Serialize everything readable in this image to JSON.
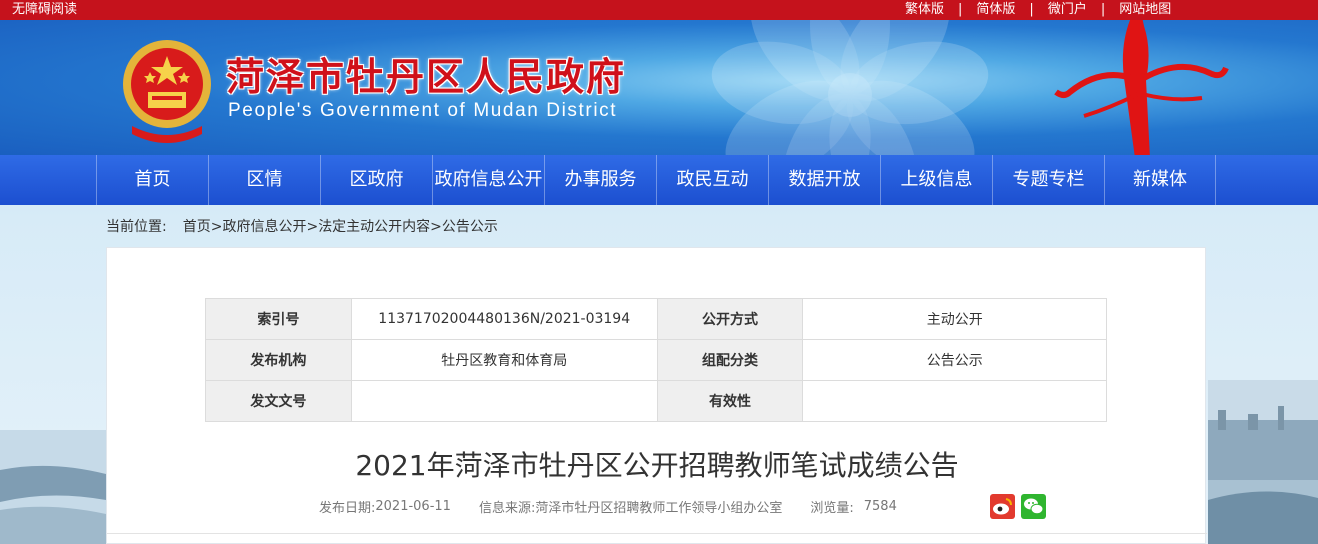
{
  "topbar": {
    "accessibility": "无障碍阅读",
    "links": [
      "繁体版",
      "简体版",
      "微门户",
      "网站地图"
    ],
    "separator": "|"
  },
  "banner": {
    "title_cn": "菏泽市牡丹区人民政府",
    "title_en": "People's Government of Mudan District"
  },
  "nav": {
    "items": [
      "首页",
      "区情",
      "区政府",
      "政府信息公开",
      "办事服务",
      "政民互动",
      "数据开放",
      "上级信息",
      "专题专栏",
      "新媒体"
    ]
  },
  "breadcrumb": {
    "label": "当前位置:",
    "items": [
      "首页>",
      "政府信息公开>",
      "法定主动公开内容>",
      "公告公示"
    ]
  },
  "meta": {
    "rows": [
      {
        "k1": "索引号",
        "v1": "11371702004480136N/2021-03194",
        "k2": "公开方式",
        "v2": "主动公开"
      },
      {
        "k1": "发布机构",
        "v1": "牡丹区教育和体育局",
        "k2": "组配分类",
        "v2": "公告公示"
      },
      {
        "k1": "发文文号",
        "v1": "",
        "k2": "有效性",
        "v2": ""
      }
    ]
  },
  "article": {
    "title": "2021年菏泽市牡丹区公开招聘教师笔试成绩公告",
    "date_label": "发布日期:",
    "date": "2021-06-11",
    "source_label": "信息来源:",
    "source": "菏泽市牡丹区招聘教师工作领导小组办公室",
    "views_label": "浏览量:",
    "views": "7584"
  },
  "share": {
    "icons": [
      "weibo-icon",
      "wechat-icon"
    ]
  },
  "colors": {
    "topbar": "#c5121c",
    "nav": "#2459d8",
    "title_red": "#d0111a"
  }
}
